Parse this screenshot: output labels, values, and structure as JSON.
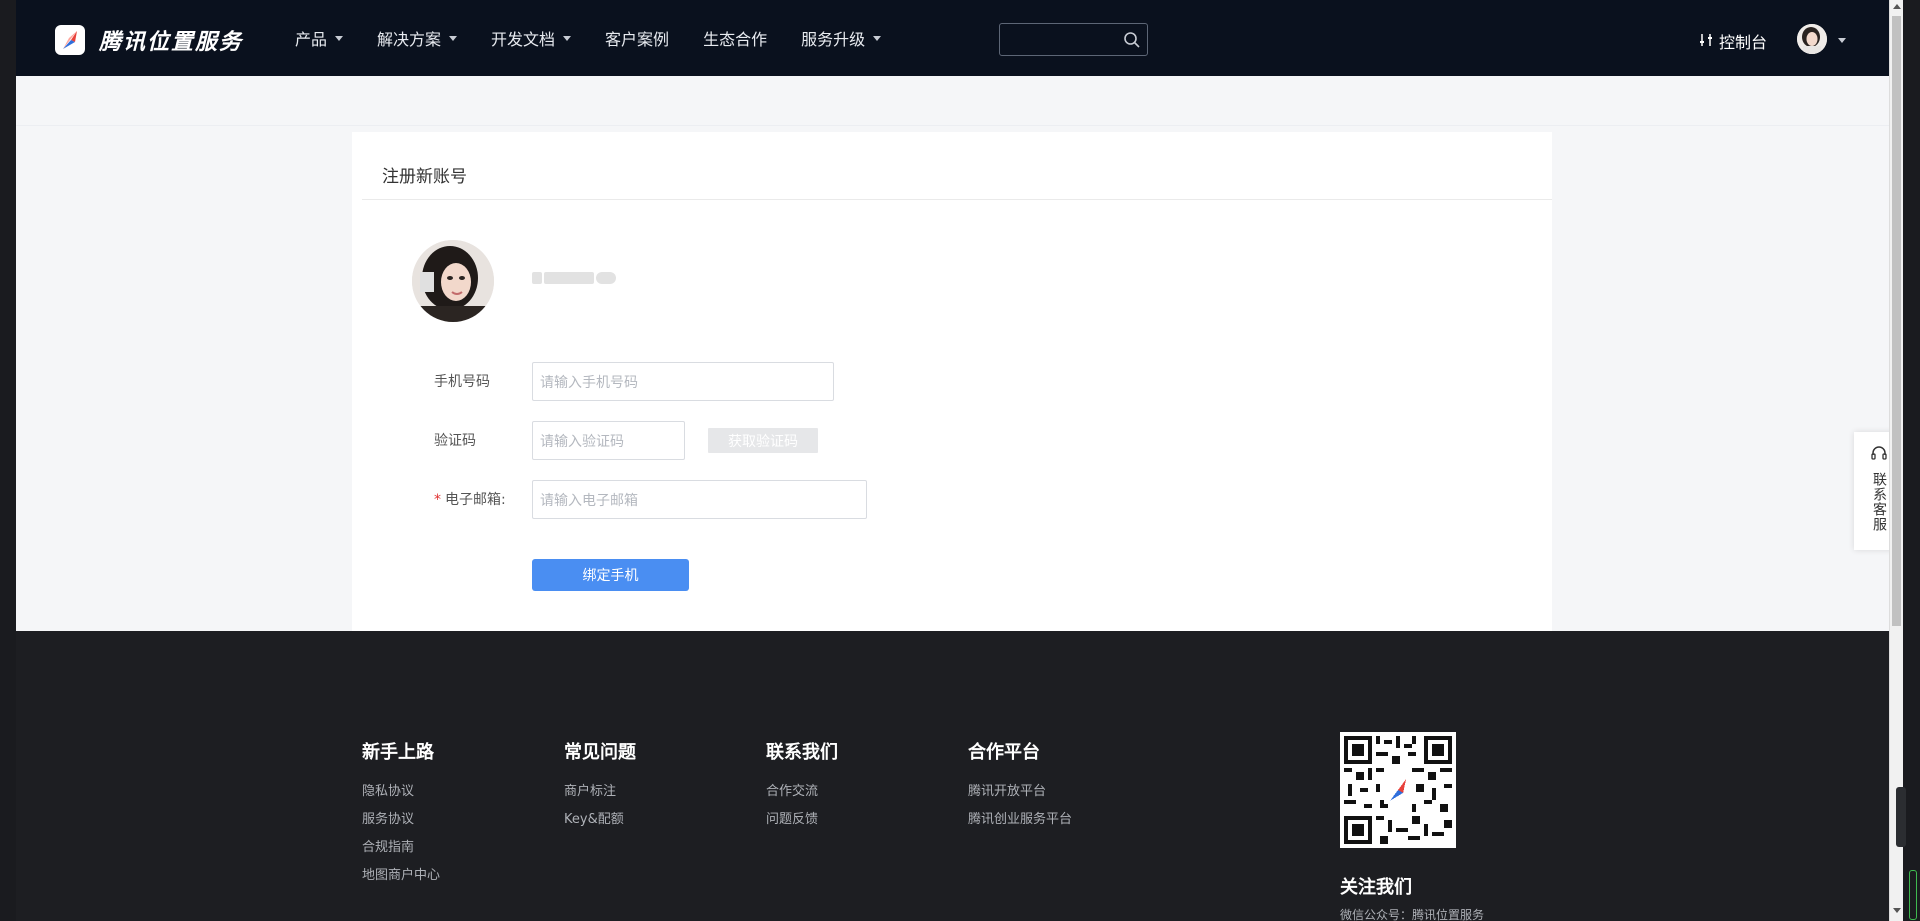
{
  "header": {
    "brand": "腾讯位置服务",
    "nav": [
      {
        "label": "产品",
        "dropdown": true
      },
      {
        "label": "解决方案",
        "dropdown": true
      },
      {
        "label": "开发文档",
        "dropdown": true
      },
      {
        "label": "客户案例",
        "dropdown": false
      },
      {
        "label": "生态合作",
        "dropdown": false
      },
      {
        "label": "服务升级",
        "dropdown": true
      }
    ],
    "search_value": "",
    "console_label": "控制台"
  },
  "card": {
    "title": "注册新账号",
    "form": {
      "phone_label": "手机号码",
      "phone_placeholder": "请输入手机号码",
      "code_label": "验证码",
      "code_placeholder": "请输入验证码",
      "code_button": "获取验证码",
      "email_required_mark": "*",
      "email_label": "电子邮箱:",
      "email_placeholder": "请输入电子邮箱",
      "submit_label": "绑定手机"
    }
  },
  "service_float": {
    "label": "联系客服"
  },
  "footer": {
    "columns": [
      {
        "title": "新手上路",
        "links": [
          "隐私协议",
          "服务协议",
          "合规指南",
          "地图商户中心"
        ]
      },
      {
        "title": "常见问题",
        "links": [
          "商户标注",
          "Key&配额"
        ]
      },
      {
        "title": "联系我们",
        "links": [
          "合作交流",
          "问题反馈"
        ]
      },
      {
        "title": "合作平台",
        "links": [
          "腾讯开放平台",
          "腾讯创业服务平台"
        ]
      }
    ],
    "follow_title": "关注我们",
    "wechat_text": "微信公众号：腾讯位置服务"
  },
  "colors": {
    "header_bg": "#0a111e",
    "primary_button": "#4a8ef2",
    "footer_bg": "#1d1e22",
    "required": "#e02f2f"
  }
}
